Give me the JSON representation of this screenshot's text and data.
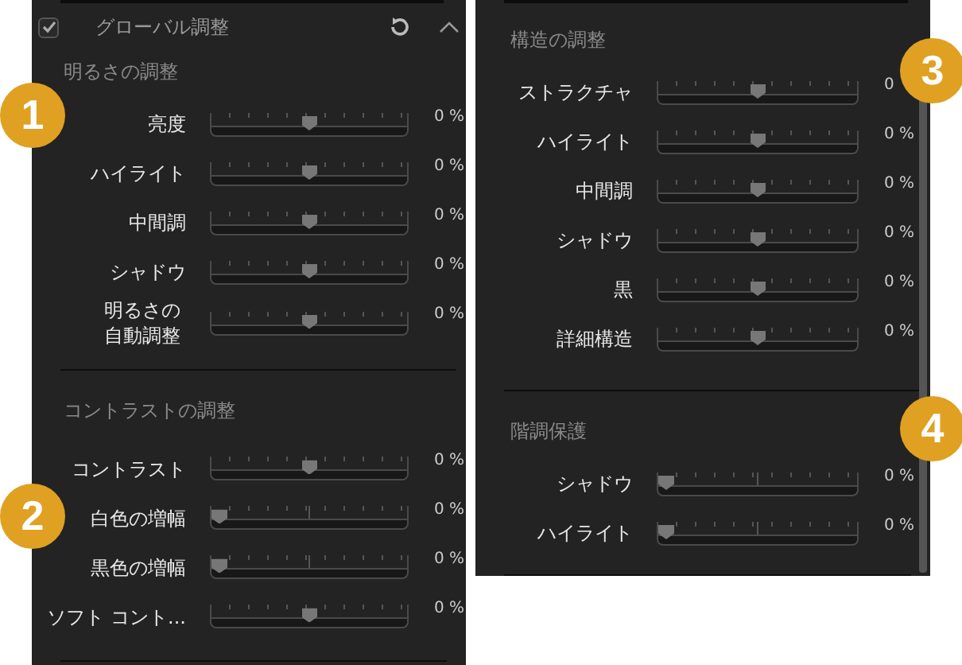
{
  "left_panel": {
    "header": {
      "title": "グローバル調整",
      "checked": true
    },
    "sections": [
      {
        "title": "明るさの調整",
        "rows": [
          {
            "label": "亮度",
            "kind": "bipolar",
            "level": 0.5,
            "value": "0 %"
          },
          {
            "label": "ハイライト",
            "kind": "bipolar",
            "level": 0.5,
            "value": "0 %"
          },
          {
            "label": "中間調",
            "kind": "bipolar",
            "level": 0.5,
            "value": "0 %"
          },
          {
            "label": "シャドウ",
            "kind": "bipolar",
            "level": 0.5,
            "value": "0 %"
          },
          {
            "label": "明るさの自動調整",
            "wrap": true,
            "kind": "bipolar",
            "level": 0.5,
            "value": "0 %"
          }
        ]
      },
      {
        "title": "コントラストの調整",
        "rows": [
          {
            "label": "コントラスト",
            "kind": "bipolar",
            "level": 0.5,
            "value": "0 %"
          },
          {
            "label": "白色の増幅",
            "kind": "unipolar",
            "level": 0,
            "value": "0 %"
          },
          {
            "label": "黒色の増幅",
            "kind": "unipolar",
            "level": 0,
            "value": "0 %"
          },
          {
            "label": "ソフト コント...",
            "kind": "bipolar",
            "level": 0.5,
            "value": "0 %"
          }
        ]
      }
    ]
  },
  "right_panel": {
    "sections": [
      {
        "title": "構造の調整",
        "rows": [
          {
            "label": "ストラクチャ",
            "kind": "bipolar",
            "level": 0.5,
            "value": "0"
          },
          {
            "label": "ハイライト",
            "kind": "bipolar",
            "level": 0.5,
            "value": "0 %"
          },
          {
            "label": "中間調",
            "kind": "bipolar",
            "level": 0.5,
            "value": "0 %"
          },
          {
            "label": "シャドウ",
            "kind": "bipolar",
            "level": 0.5,
            "value": "0 %"
          },
          {
            "label": "黒",
            "kind": "bipolar",
            "level": 0.5,
            "value": "0 %"
          },
          {
            "label": "詳細構造",
            "kind": "bipolar",
            "level": 0.5,
            "value": "0 %"
          }
        ]
      },
      {
        "title": "階調保護",
        "rows": [
          {
            "label": "シャドウ",
            "kind": "unipolar",
            "level": 0,
            "value": "0 %"
          },
          {
            "label": "ハイライト",
            "kind": "unipolar",
            "level": 0,
            "value": "0 %"
          }
        ]
      }
    ]
  },
  "callouts": [
    "1",
    "2",
    "3",
    "4"
  ]
}
